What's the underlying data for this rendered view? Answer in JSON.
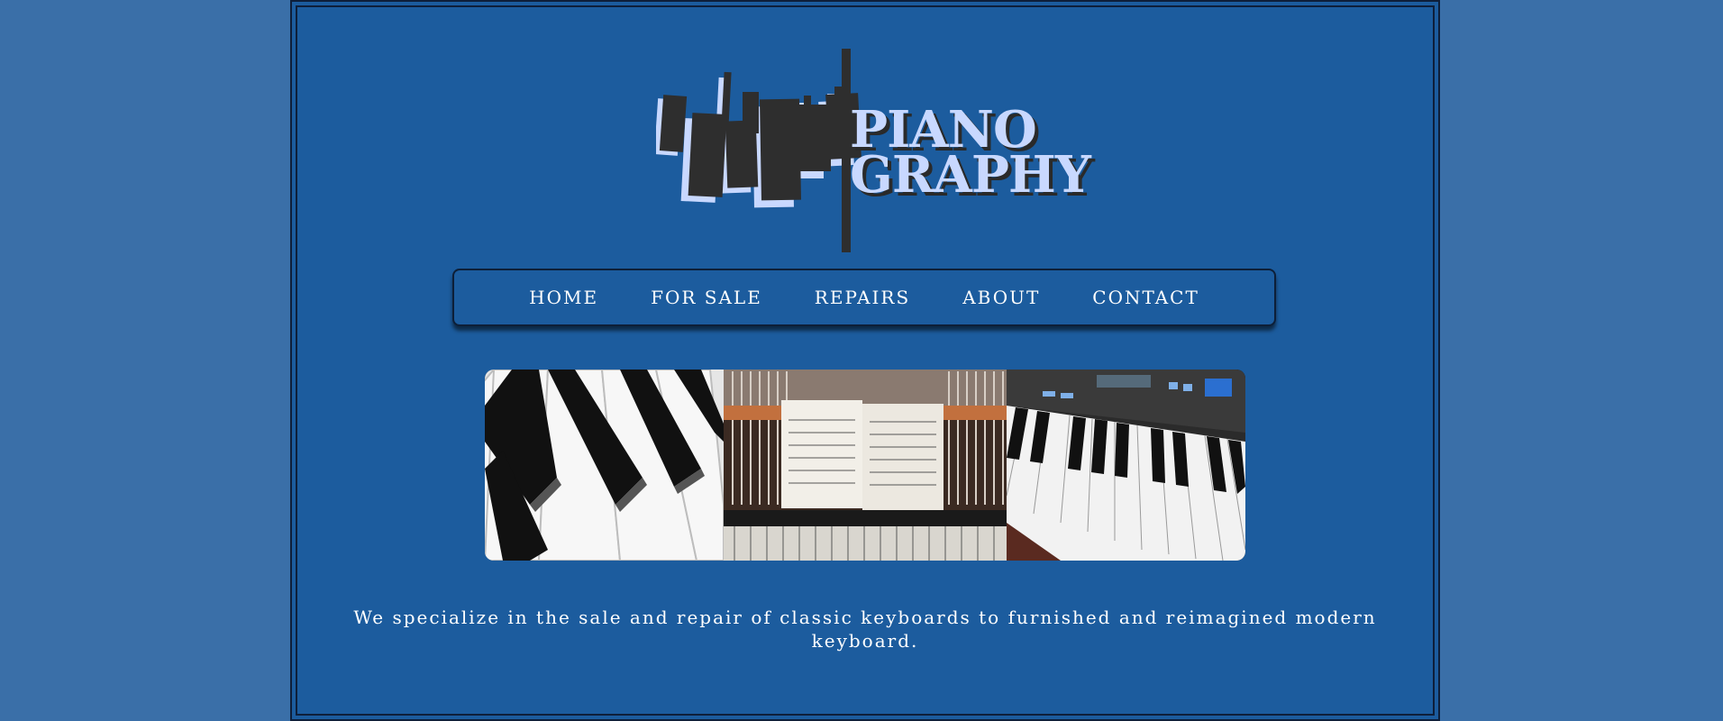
{
  "logo": {
    "word_top": "PIANO",
    "word_bottom": "GRAPHY"
  },
  "nav": {
    "items": [
      {
        "label": "HOME"
      },
      {
        "label": "FOR SALE"
      },
      {
        "label": "REPAIRS"
      },
      {
        "label": "ABOUT"
      },
      {
        "label": "CONTACT"
      }
    ]
  },
  "gallery": {
    "images": [
      {
        "subject": "piano-keys-closeup"
      },
      {
        "subject": "sheet-music-on-open-piano"
      },
      {
        "subject": "digital-keyboard-synthesizer"
      }
    ]
  },
  "tagline": "We specialize in the sale and repair of classic keyboards to furnished and reimagined modern keyboard.",
  "colors": {
    "page_background": "#3a6fa8",
    "panel_background": "#1c5c9e",
    "border": "#0e1f3a",
    "logo_text": "#c8d8ff",
    "logo_dark": "#2e2e2e"
  }
}
